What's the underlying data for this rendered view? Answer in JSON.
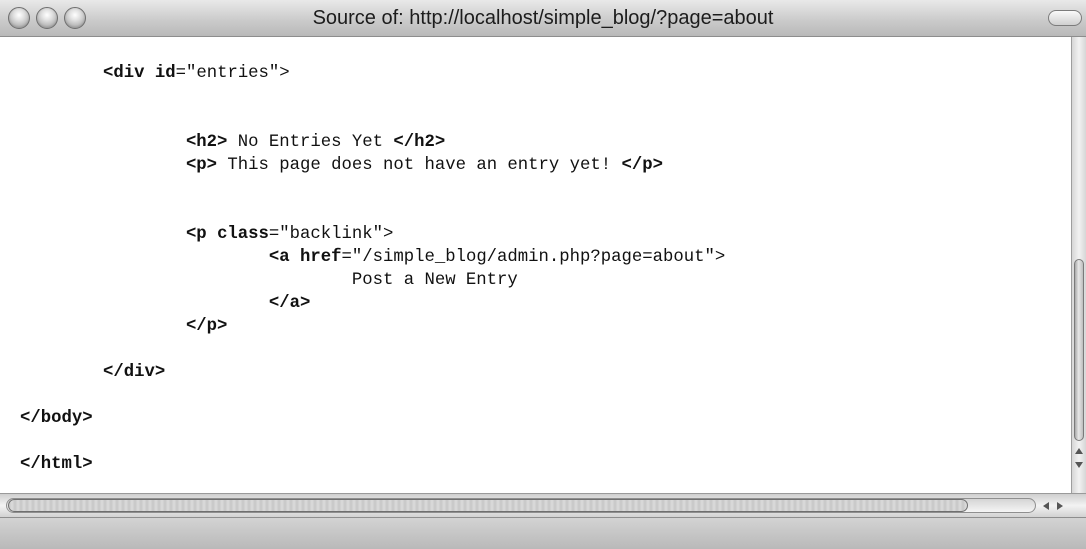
{
  "window": {
    "title": "Source of: http://localhost/simple_blog/?page=about"
  },
  "source": {
    "lines": [
      {
        "indent": "        ",
        "parts": [
          {
            "t": "<",
            "k": "tag"
          },
          {
            "t": "div",
            "k": "tag"
          },
          {
            "t": " ",
            "k": "plain"
          },
          {
            "t": "id",
            "k": "attr"
          },
          {
            "t": "=\"entries\">",
            "k": "plain"
          }
        ]
      },
      {
        "indent": "",
        "parts": []
      },
      {
        "indent": "",
        "parts": []
      },
      {
        "indent": "                ",
        "parts": [
          {
            "t": "<h2>",
            "k": "tag"
          },
          {
            "t": " No Entries Yet ",
            "k": "plain"
          },
          {
            "t": "</h2>",
            "k": "tag"
          }
        ]
      },
      {
        "indent": "                ",
        "parts": [
          {
            "t": "<p>",
            "k": "tag"
          },
          {
            "t": " This page does not have an entry yet! ",
            "k": "plain"
          },
          {
            "t": "</p>",
            "k": "tag"
          }
        ]
      },
      {
        "indent": "",
        "parts": []
      },
      {
        "indent": "",
        "parts": []
      },
      {
        "indent": "                ",
        "parts": [
          {
            "t": "<p",
            "k": "tag"
          },
          {
            "t": " ",
            "k": "plain"
          },
          {
            "t": "class",
            "k": "attr"
          },
          {
            "t": "=\"backlink\">",
            "k": "plain"
          }
        ]
      },
      {
        "indent": "                        ",
        "parts": [
          {
            "t": "<a",
            "k": "tag"
          },
          {
            "t": " ",
            "k": "plain"
          },
          {
            "t": "href",
            "k": "attr"
          },
          {
            "t": "=\"/simple_blog/admin.php?page=about\">",
            "k": "plain"
          }
        ]
      },
      {
        "indent": "                                ",
        "parts": [
          {
            "t": "Post a New Entry",
            "k": "plain"
          }
        ]
      },
      {
        "indent": "                        ",
        "parts": [
          {
            "t": "</a>",
            "k": "tag"
          }
        ]
      },
      {
        "indent": "                ",
        "parts": [
          {
            "t": "</p>",
            "k": "tag"
          }
        ]
      },
      {
        "indent": "",
        "parts": []
      },
      {
        "indent": "        ",
        "parts": [
          {
            "t": "</div>",
            "k": "tag"
          }
        ]
      },
      {
        "indent": "",
        "parts": []
      },
      {
        "indent": "",
        "parts": [
          {
            "t": "</body>",
            "k": "tag"
          }
        ]
      },
      {
        "indent": "",
        "parts": []
      },
      {
        "indent": "",
        "parts": [
          {
            "t": "</html>",
            "k": "tag"
          }
        ]
      }
    ]
  },
  "scrollbars": {
    "vertical_position_fraction": 0.57,
    "horizontal_position_fraction": 0.0
  }
}
